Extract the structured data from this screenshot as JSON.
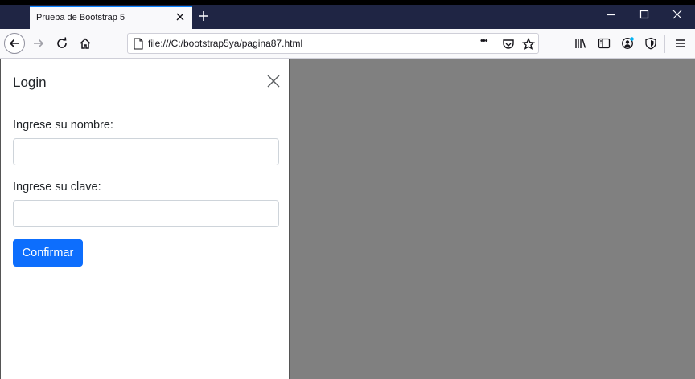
{
  "browser": {
    "tab_title": "Prueba de Bootstrap 5",
    "url": "file:///C:/bootstrap5ya/pagina87.html",
    "url_more": "•••"
  },
  "offcanvas": {
    "title": "Login",
    "name_label": "Ingrese su nombre:",
    "name_value": "",
    "password_label": "Ingrese su clave:",
    "password_value": "",
    "confirm_button": "Confirmar"
  },
  "colors": {
    "primary": "#0d6efd",
    "backdrop": "#808080",
    "titlebar": "#1f2544"
  }
}
